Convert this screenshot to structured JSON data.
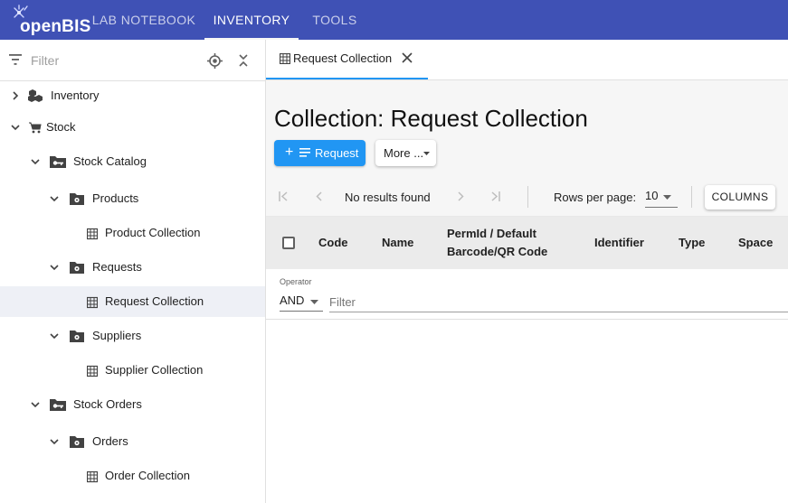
{
  "app": {
    "logo_text": "openBIS",
    "nav_tabs": [
      {
        "label": "LAB NOTEBOOK",
        "active": false
      },
      {
        "label": "INVENTORY",
        "active": true
      },
      {
        "label": "TOOLS",
        "active": false
      }
    ],
    "colors": {
      "appbar": "#3f51b5",
      "primary": "#2196f3",
      "selected_row": "#eef0f6"
    }
  },
  "sidebar": {
    "filter_placeholder": "Filter",
    "icons": [
      "filter-icon",
      "locate-icon",
      "collapse-all-icon"
    ],
    "tree": [
      {
        "label": "Inventory",
        "icon": "inventory-icon",
        "expanded": false
      },
      {
        "label": "Stock",
        "icon": "cart-icon",
        "expanded": true
      },
      {
        "label": "Stock Catalog",
        "icon": "folder-key-icon",
        "expanded": true
      },
      {
        "label": "Products",
        "icon": "folder-gear-icon",
        "expanded": true
      },
      {
        "label": "Product Collection",
        "icon": "table-icon"
      },
      {
        "label": "Requests",
        "icon": "folder-gear-icon",
        "expanded": true
      },
      {
        "label": "Request Collection",
        "icon": "table-icon",
        "selected": true
      },
      {
        "label": "Suppliers",
        "icon": "folder-gear-icon",
        "expanded": true
      },
      {
        "label": "Supplier Collection",
        "icon": "table-icon"
      },
      {
        "label": "Stock Orders",
        "icon": "folder-key-icon",
        "expanded": true
      },
      {
        "label": "Orders",
        "icon": "folder-gear-icon",
        "expanded": true
      },
      {
        "label": "Order Collection",
        "icon": "table-icon"
      }
    ]
  },
  "main": {
    "tab": {
      "label": "Request Collection",
      "icon": "table-icon"
    },
    "title": "Collection: Request Collection",
    "actions": {
      "primary_label": "Request",
      "more_label": "More ..."
    },
    "grid": {
      "pager": {
        "status": "No results found",
        "rows_per_page_label": "Rows per page:",
        "rows_per_page_value": "10",
        "columns_label": "COLUMNS"
      },
      "columns": [
        "Code",
        "Name",
        "PermId / Default",
        "Barcode/QR Code",
        "Identifier",
        "Type",
        "Space"
      ],
      "filter": {
        "operator_label": "Operator",
        "operator_value": "AND",
        "placeholder": "Filter"
      }
    }
  }
}
